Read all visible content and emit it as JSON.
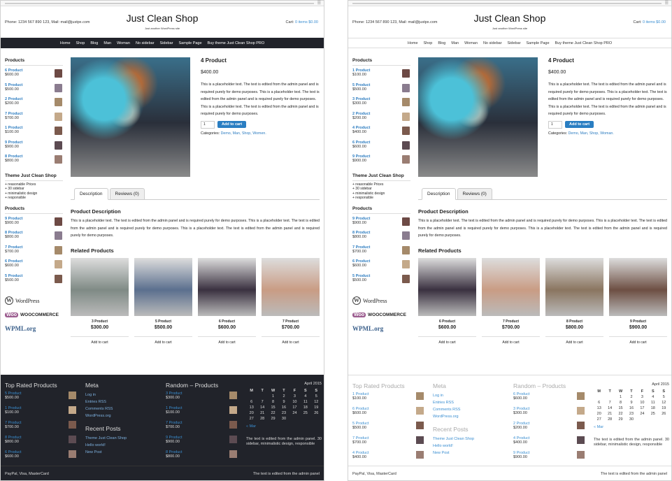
{
  "site": {
    "phone": "Phone: 1234 567 890 123, Mail: mail@justpx.com",
    "title": "Just Clean Shop",
    "tagline": "Just another WordPress site",
    "cart_label": "Cart: ",
    "cart_link": "0 items $0.00"
  },
  "nav": [
    "Home",
    "Shop",
    "Blog",
    "Man",
    "Woman",
    "No sidebar",
    "Sidebar",
    "Sample Page",
    "Buy theme Just Clean Shop PRO"
  ],
  "sidebar": {
    "products_title": "Products",
    "theme_title": "Theme Just Clean Shop",
    "theme_list": [
      "+ reasonable Prices",
      "+ 30 sidebar",
      "+ minimalistic design",
      "+ responsible"
    ],
    "products2_title": "Products"
  },
  "left": {
    "products1": [
      {
        "n": "6 Product",
        "p": "$600.00"
      },
      {
        "n": "5 Product",
        "p": "$500.00"
      },
      {
        "n": "2 Product",
        "p": "$200.00"
      },
      {
        "n": "7 Product",
        "p": "$700.00"
      },
      {
        "n": "1 Product",
        "p": "$100.00"
      },
      {
        "n": "9 Product",
        "p": "$900.00"
      },
      {
        "n": "8 Product",
        "p": "$800.00"
      }
    ],
    "products2": [
      {
        "n": "9 Product",
        "p": "$900.00"
      },
      {
        "n": "8 Product",
        "p": "$800.00"
      },
      {
        "n": "7 Product",
        "p": "$700.00"
      },
      {
        "n": "6 Product",
        "p": "$600.00"
      },
      {
        "n": "5 Product",
        "p": "$500.00"
      }
    ],
    "related": [
      {
        "n": "3 Product",
        "p": "$300.00"
      },
      {
        "n": "5 Product",
        "p": "$500.00"
      },
      {
        "n": "6 Product",
        "p": "$600.00"
      },
      {
        "n": "7 Product",
        "p": "$700.00"
      }
    ],
    "top_rated": [
      {
        "n": "5 Product",
        "p": "$500.00"
      },
      {
        "n": "1 Product",
        "p": "$100.00"
      },
      {
        "n": "7 Product",
        "p": "$700.00"
      },
      {
        "n": "8 Product",
        "p": "$800.00"
      },
      {
        "n": "6 Product",
        "p": "$600.00"
      }
    ],
    "random": [
      {
        "n": "3 Product",
        "p": "$300.00"
      },
      {
        "n": "1 Product",
        "p": "$100.00"
      },
      {
        "n": "7 Product",
        "p": "$700.00"
      },
      {
        "n": "9 Product",
        "p": "$900.00"
      },
      {
        "n": "8 Product",
        "p": "$800.00"
      }
    ]
  },
  "right": {
    "products1": [
      {
        "n": "1 Product",
        "p": "$100.00"
      },
      {
        "n": "5 Product",
        "p": "$500.00"
      },
      {
        "n": "3 Product",
        "p": "$300.00"
      },
      {
        "n": "2 Product",
        "p": "$200.00"
      },
      {
        "n": "4 Product",
        "p": "$400.00"
      },
      {
        "n": "6 Product",
        "p": "$600.00"
      },
      {
        "n": "9 Product",
        "p": "$900.00"
      }
    ],
    "products2": [
      {
        "n": "9 Product",
        "p": "$900.00"
      },
      {
        "n": "8 Product",
        "p": "$800.00"
      },
      {
        "n": "7 Product",
        "p": "$700.00"
      },
      {
        "n": "6 Product",
        "p": "$600.00"
      },
      {
        "n": "5 Product",
        "p": "$500.00"
      }
    ],
    "related": [
      {
        "n": "6 Product",
        "p": "$600.00"
      },
      {
        "n": "7 Product",
        "p": "$700.00"
      },
      {
        "n": "8 Product",
        "p": "$800.00"
      },
      {
        "n": "9 Product",
        "p": "$900.00"
      }
    ],
    "top_rated": [
      {
        "n": "1 Product",
        "p": "$100.00"
      },
      {
        "n": "6 Product",
        "p": "$600.00"
      },
      {
        "n": "5 Product",
        "p": "$500.00"
      },
      {
        "n": "7 Product",
        "p": "$700.00"
      },
      {
        "n": "4 Product",
        "p": "$400.00"
      }
    ],
    "random": [
      {
        "n": "6 Product",
        "p": "$600.00"
      },
      {
        "n": "3 Product",
        "p": "$300.00"
      },
      {
        "n": "2 Product",
        "p": "$200.00"
      },
      {
        "n": "4 Product",
        "p": "$400.00"
      },
      {
        "n": "9 Product",
        "p": "$900.00"
      }
    ]
  },
  "product": {
    "title": "4 Product",
    "price": "$400.00",
    "desc": "This is a placeholder text. The text is edited from the admin panel and is required purely for demo purposes. This is a placeholder text. The text is edited from the admin panel and is required purely for demo purposes. This is a placeholder text. The text is edited from the admin panel and is required purely for demo purposes.",
    "qty": "1",
    "add": "Add to cart",
    "cats_label": "Categories: ",
    "cats": "Demo, Man, Shop, Women.",
    "cats_right": "Demo, Man, Shop, Woman."
  },
  "tabs": {
    "desc": "Description",
    "reviews": "Reviews (0)"
  },
  "pdesc": {
    "title": "Product Description",
    "text": "This is a placeholder text. The text is edited from the admin panel and is required purely for demo purposes. This is a placeholder text. The text is edited from the admin panel and is required purely for demo purposes. This is a placeholder text. The text is edited from the admin panel and is required purely for demo purposes."
  },
  "related_title": "Related Products",
  "add_to_cart": "Add to cart",
  "footer": {
    "top_rated": "Top Rated Products",
    "meta": "Meta",
    "meta_links": [
      "Log in",
      "Entries RSS",
      "Comments RSS",
      "WordPress.org"
    ],
    "recent": "Recent Posts",
    "recent_links": [
      "Theme Just Clean Shop",
      "Hello world!",
      "New Post"
    ],
    "random": "Random – Products",
    "cal_caption": "April 2015",
    "cal_head": [
      "M",
      "T",
      "W",
      "T",
      "F",
      "S",
      "S"
    ],
    "cal_rows": [
      [
        "",
        "",
        "1",
        "2",
        "3",
        "4",
        "5"
      ],
      [
        "6",
        "7",
        "8",
        "9",
        "10",
        "11",
        "12"
      ],
      [
        "13",
        "14",
        "15",
        "16",
        "17",
        "18",
        "19"
      ],
      [
        "20",
        "21",
        "22",
        "23",
        "24",
        "25",
        "26"
      ],
      [
        "27",
        "28",
        "29",
        "30",
        "",
        "",
        ""
      ]
    ],
    "cal_prev": "« Mar",
    "cal_text": "The text is edited from the admin panel. 30 sidebar, minimalistic design, responsible",
    "bottom_left": "PayPal, Visa, MasterCard",
    "bottom_right": "The text is edited from the admin panel"
  },
  "logos": {
    "wordpress": "WordPress",
    "woocommerce": "WOOCOMMERCE",
    "wpml": "WPML.org"
  },
  "colors": {
    "accent": "#2a7ec2",
    "dark": "#21232a"
  }
}
